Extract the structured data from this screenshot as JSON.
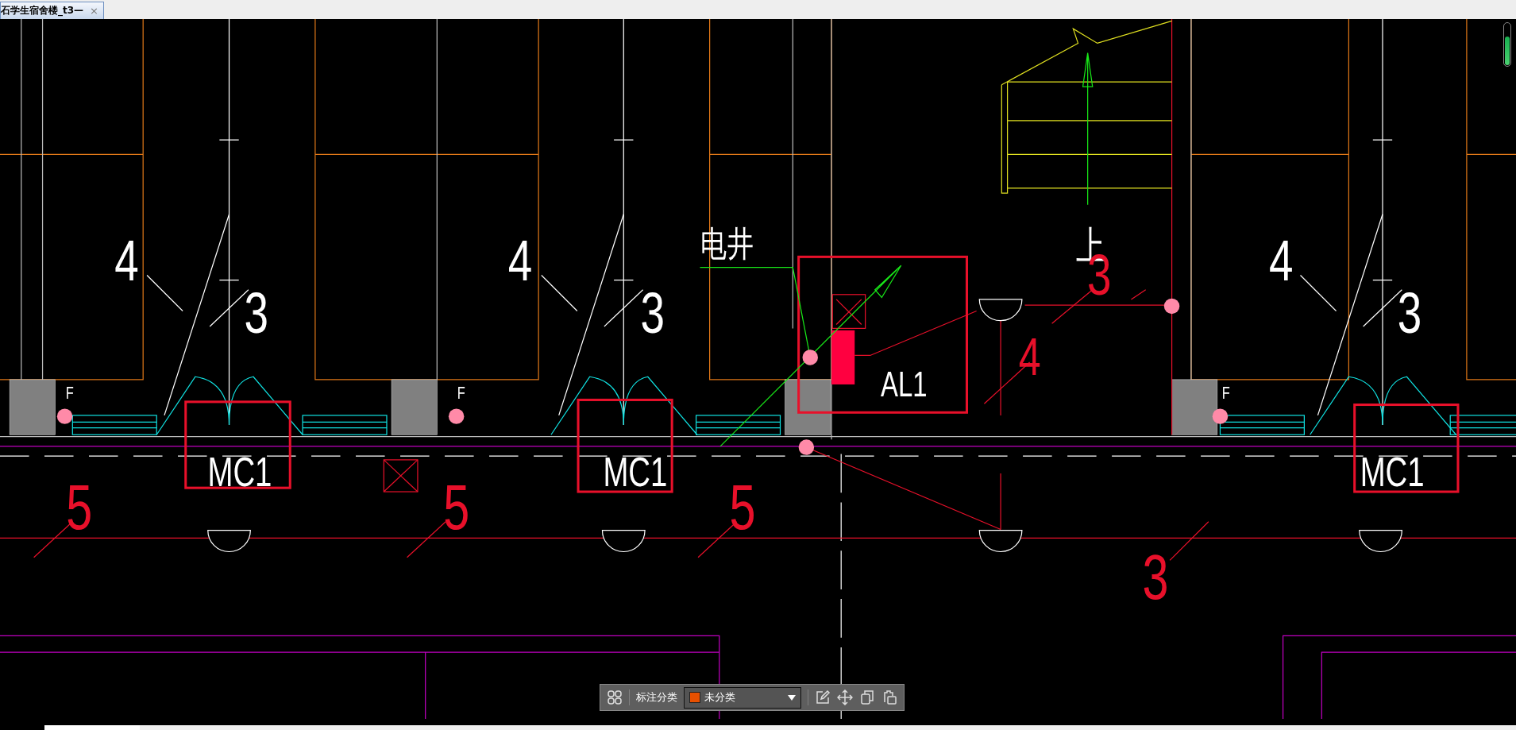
{
  "document_tab": {
    "title": "石学生宿舍楼_t3—",
    "close": "×",
    "selected": true
  },
  "drawing": {
    "labels": [
      {
        "text": "电井",
        "color": "#ffffff"
      },
      {
        "text": "上",
        "color": "#ffffff"
      },
      {
        "text": "4",
        "color": "#ffffff"
      },
      {
        "text": "4",
        "color": "#ffffff"
      },
      {
        "text": "3",
        "color": "#e8102a"
      },
      {
        "text": "4",
        "color": "#ffffff"
      },
      {
        "text": "3",
        "color": "#ffffff"
      },
      {
        "text": "3",
        "color": "#ffffff"
      },
      {
        "text": "3",
        "color": "#ffffff"
      },
      {
        "text": "4",
        "color": "#e8102a"
      },
      {
        "text": "F",
        "color": "#ffffff"
      },
      {
        "text": "F",
        "color": "#ffffff"
      },
      {
        "text": "AL1",
        "color": "#ffffff"
      },
      {
        "text": "F",
        "color": "#ffffff"
      },
      {
        "text": "MC1",
        "color": "#ffffff"
      },
      {
        "text": "MC1",
        "color": "#ffffff"
      },
      {
        "text": "MC1",
        "color": "#ffffff"
      },
      {
        "text": "5",
        "color": "#e8102a"
      },
      {
        "text": "5",
        "color": "#e8102a"
      },
      {
        "text": "5",
        "color": "#e8102a"
      },
      {
        "text": "3",
        "color": "#e8102a"
      }
    ]
  },
  "annotation_toolbar": {
    "label": "标注分类",
    "category": {
      "label": "未分类",
      "color": "#e85000"
    }
  }
}
